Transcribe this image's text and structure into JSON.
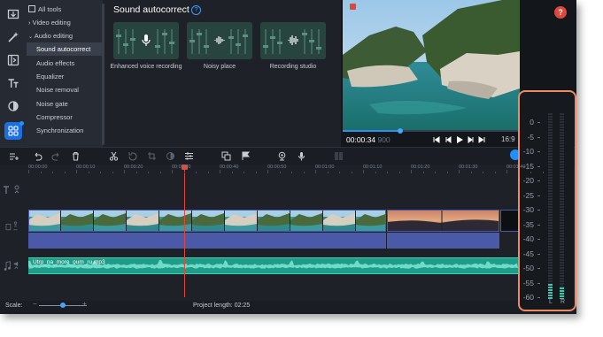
{
  "sidebar": {
    "tools": [
      {
        "icon": "import-icon"
      },
      {
        "icon": "magic-wand-icon"
      },
      {
        "icon": "transitions-icon"
      },
      {
        "icon": "titles-icon"
      },
      {
        "icon": "filters-icon"
      },
      {
        "icon": "more-tools-icon"
      }
    ]
  },
  "categories": {
    "all_tools": "All tools",
    "video_editing": "Video editing",
    "audio_editing": "Audio editing",
    "items": [
      "Sound autocorrect",
      "Audio effects",
      "Equalizer",
      "Noise removal",
      "Noise gate",
      "Compressor",
      "Synchronization"
    ],
    "selected": "Sound autocorrect"
  },
  "panel": {
    "title": "Sound autocorrect",
    "presets": [
      "Enhanced voice recording",
      "Noisy place",
      "Recording studio"
    ]
  },
  "player": {
    "time": "00:00:34",
    "time_frac": "900",
    "ratio": "16:9",
    "help": "?",
    "progress": 0.32
  },
  "timeline": {
    "ruler": [
      "00:00:00",
      "00:00:10",
      "00:00:20",
      "00:00:30",
      "00:00:40",
      "00:00:50",
      "00:01:00",
      "00:01:10",
      "00:01:20",
      "00:01:30",
      "00:01:40"
    ],
    "audio_clip": "Utro_na_more_oum_ru.mp3"
  },
  "footer": {
    "scale_label": "Scale:",
    "project_length": "Project length:",
    "project_length_value": "02:25"
  },
  "meter": {
    "labels": [
      "0",
      "-5",
      "-10",
      "-15",
      "-20",
      "-25",
      "-30",
      "-35",
      "-40",
      "-45",
      "-50",
      "-55",
      "-60"
    ],
    "left_label": "L",
    "right_label": "R",
    "left_level": 0.08,
    "right_level": 0.06
  },
  "colors": {
    "accent": "#1e90ff",
    "playhead": "#e0473c",
    "audio_track": "#1f9c88",
    "highlight_box": "#f08a60"
  }
}
